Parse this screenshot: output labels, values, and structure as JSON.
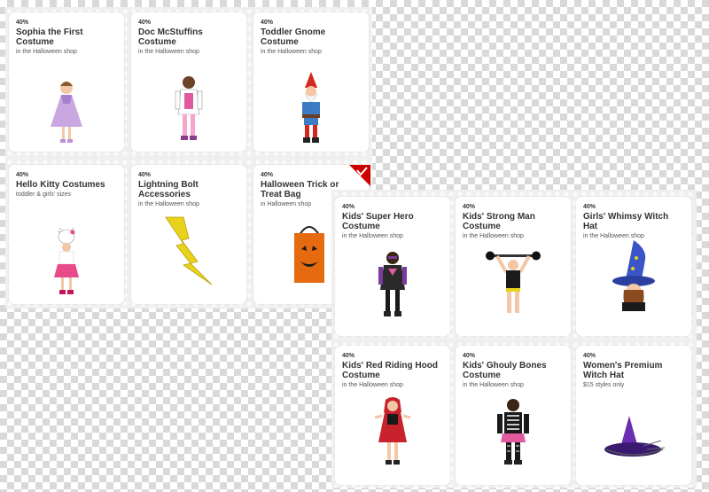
{
  "panel_left": {
    "cards": [
      {
        "discount": "40%",
        "title": "Sophia the First Costume",
        "subtitle": "in the Halloween shop",
        "image": "girl-purple-princess-dress-costume",
        "accent": "#c9a7e0"
      },
      {
        "discount": "40%",
        "title": "Doc McStuffins Costume",
        "subtitle": "in the Halloween shop",
        "image": "girl-doctor-costume",
        "accent": "#e05aa0"
      },
      {
        "discount": "40%",
        "title": "Toddler Gnome Costume",
        "subtitle": "in the Halloween shop",
        "image": "toddler-gnome-costume",
        "accent": "#3d7cc4"
      },
      {
        "discount": "40%",
        "title": "Hello Kitty Costumes",
        "subtitle": "toddler & girls' sizes",
        "image": "girl-hello-kitty-costume",
        "accent": "#e84b8a"
      },
      {
        "discount": "40%",
        "title": "Lightning Bolt Accessories",
        "subtitle": "in the Halloween shop",
        "image": "lightning-bolt-accessory",
        "accent": "#e8d21c"
      },
      {
        "discount": "40%",
        "title": "Halloween Trick or Treat Bag",
        "subtitle": "in Halloween shop",
        "image": "pumpkin-treat-bag",
        "accent": "#e66a10"
      }
    ]
  },
  "panel_right": {
    "cards": [
      {
        "discount": "40%",
        "title": "Kids' Super Hero Costume",
        "subtitle": "in the Halloween shop",
        "image": "girl-super-hero-costume",
        "accent": "#7b3a9c"
      },
      {
        "discount": "40%",
        "title": "Kids' Strong Man Costume",
        "subtitle": "in the Halloween shop",
        "image": "strong-man-costume",
        "accent": "#222222"
      },
      {
        "discount": "40%",
        "title": "Girls' Whimsy Witch Hat",
        "subtitle": "in the Halloween shop",
        "image": "girl-witch-hat",
        "accent": "#3b55c8"
      },
      {
        "discount": "40%",
        "title": "Kids' Red Riding Hood Costume",
        "subtitle": "in the Halloween shop",
        "image": "red-riding-hood-costume",
        "accent": "#c8232c"
      },
      {
        "discount": "40%",
        "title": "Kids' Ghouly Bones Costume",
        "subtitle": "in the Halloween shop",
        "image": "skeleton-costume",
        "accent": "#e05aa0"
      },
      {
        "discount": "40%",
        "title": "Women's Premium Witch Hat",
        "subtitle": "$15 styles only",
        "image": "purple-witch-hat",
        "accent": "#6a2fb0"
      }
    ]
  },
  "badge": {
    "icon": "red-checkmark-corner-icon",
    "color": "#cc0000"
  }
}
